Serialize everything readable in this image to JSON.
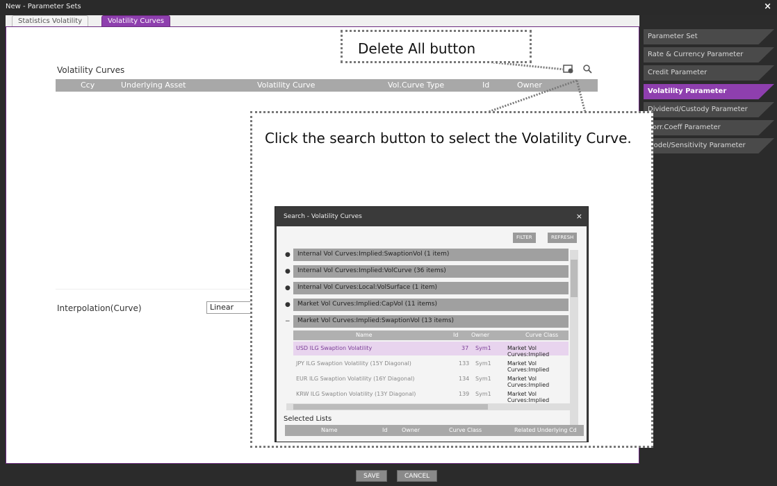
{
  "window": {
    "title": "New - Parameter Sets",
    "close": "×"
  },
  "tabs": [
    {
      "label": "Statistics Volatility",
      "active": false
    },
    {
      "label": "Volatility Curves",
      "active": true
    }
  ],
  "main": {
    "section_title": "Volatility Curves",
    "columns": [
      "Ccy",
      "Underlying Asset",
      "Volatility Curve",
      "Vol.Curve Type",
      "Id",
      "Owner"
    ],
    "icons": [
      "delete-all-icon",
      "search-icon"
    ],
    "interpolation_label": "Interpolation(Curve)",
    "interpolation_value": "Linear"
  },
  "right_panel": {
    "items": [
      {
        "label": "Parameter Set",
        "active": false
      },
      {
        "label": "Rate & Currency Parameter",
        "active": false
      },
      {
        "label": "Credit Parameter",
        "active": false
      },
      {
        "label": "Volatility Parameter",
        "active": true
      },
      {
        "label": "Dividend/Custody Parameter",
        "active": false
      },
      {
        "label": "Corr.Coeff Parameter",
        "active": false
      },
      {
        "label": "Model/Sensitivity Parameter",
        "active": false
      }
    ]
  },
  "callouts": {
    "delete_all": "Delete All button",
    "search": "Click the search button to select the Volatility Curve."
  },
  "search_dialog": {
    "title": "Search - Volatility Curves",
    "close": "×",
    "filter_label": "FILTER",
    "refresh_label": "REFRESH",
    "groups": [
      "Internal Vol Curves:Implied:SwaptionVol (1 item)",
      "Internal Vol Curves:Implied:VolCurve (36 items)",
      "Internal Vol Curves:Local:VolSurface (1 item)",
      "Market Vol Curves:Implied:CapVol (11 items)",
      "Market Vol Curves:Implied:SwaptionVol (13 items)"
    ],
    "sub_columns": [
      "Name",
      "Id",
      "Owner",
      "Curve Class"
    ],
    "rows": [
      {
        "name": "USD ILG Swaption Volatility",
        "id": "37",
        "owner": "Sym1",
        "class": "Market Vol Curves:Implied"
      },
      {
        "name": "JPY ILG Swaption Volatility (15Y Diagonal)",
        "id": "133",
        "owner": "Sym1",
        "class": "Market Vol Curves:Implied"
      },
      {
        "name": "EUR ILG Swaption Volatility (16Y Diagonal)",
        "id": "134",
        "owner": "Sym1",
        "class": "Market Vol Curves:Implied"
      },
      {
        "name": "KRW ILG Swaption Volatility (13Y Diagonal)",
        "id": "139",
        "owner": "Sym1",
        "class": "Market Vol Curves:Implied"
      }
    ],
    "selected_lists_label": "Selected Lists",
    "selected_columns": [
      "Name",
      "Id",
      "Owner",
      "Curve Class",
      "Related Underlying Cd"
    ]
  },
  "footer": {
    "save": "SAVE",
    "cancel": "CANCEL"
  }
}
